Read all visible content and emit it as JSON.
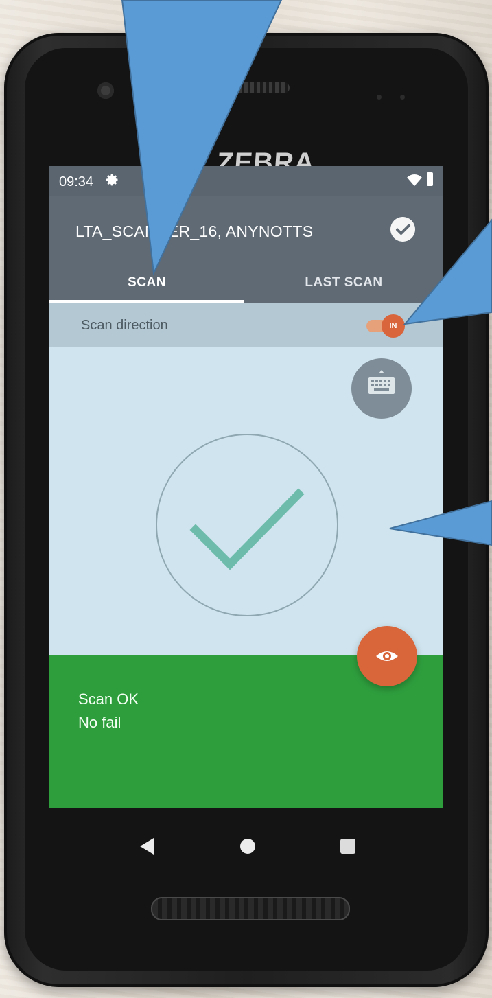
{
  "device": {
    "brand": "ZEBRA"
  },
  "status_bar": {
    "time": "09:34",
    "icons": [
      "gear-icon",
      "wifi-icon",
      "battery-icon"
    ]
  },
  "app_bar": {
    "title": "LTA_SCANNER_16, ANYNOTTS",
    "action_icon": "check-circle-icon",
    "tabs": [
      {
        "label": "SCAN",
        "selected": true
      },
      {
        "label": "LAST SCAN",
        "selected": false
      }
    ]
  },
  "scan_direction": {
    "label": "Scan direction",
    "toggle_value": "IN",
    "toggle_color": "#d8653b"
  },
  "result": {
    "status_icon": "checkmark-icon",
    "line1": "Scan OK",
    "line2": "No fail",
    "panel_color": "#2e9e3d"
  },
  "fab_buttons": {
    "keyboard_icon": "keyboard-icon",
    "eye_icon": "eye-icon",
    "eye_color": "#d9653b"
  },
  "navigation": {
    "icons": [
      "back-icon",
      "home-icon",
      "recent-apps-icon"
    ]
  },
  "colors": {
    "accent": "#d8653b",
    "app_bar": "#5f6a75",
    "success": "#2e9e3d"
  }
}
